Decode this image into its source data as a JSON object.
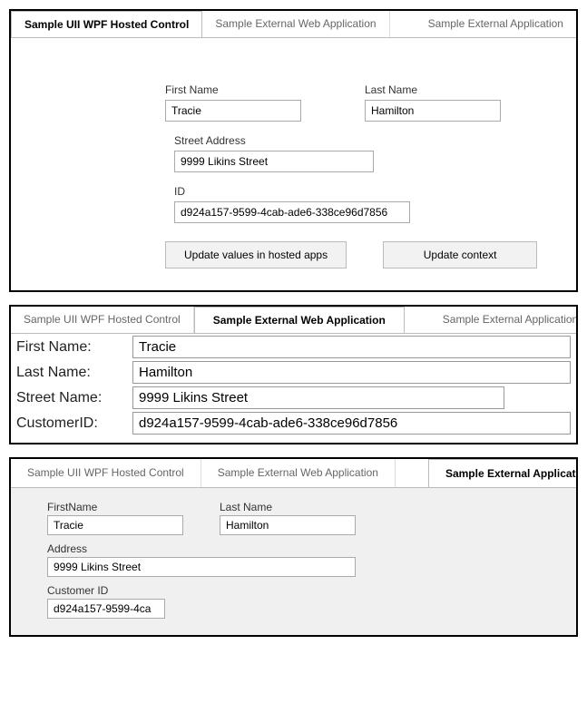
{
  "tabs": {
    "wpf": "Sample UII WPF Hosted Control",
    "web": "Sample External Web Application",
    "ext": "Sample External Application"
  },
  "panel1": {
    "firstNameLabel": "First Name",
    "firstName": "Tracie",
    "lastNameLabel": "Last Name",
    "lastName": "Hamilton",
    "streetLabel": "Street Address",
    "street": "9999 Likins Street",
    "idLabel": "ID",
    "id": "d924a157-9599-4cab-ade6-338ce96d7856",
    "btnUpdateHosted": "Update values in hosted apps",
    "btnUpdateContext": "Update context"
  },
  "panel2": {
    "firstNameLabel": "First Name:",
    "firstName": "Tracie",
    "lastNameLabel": "Last Name:",
    "lastName": "Hamilton",
    "streetLabel": "Street Name:",
    "street": "9999 Likins Street",
    "custIdLabel": "CustomerID:",
    "custId": "d924a157-9599-4cab-ade6-338ce96d7856"
  },
  "panel3": {
    "firstNameLabel": "FirstName",
    "firstName": "Tracie",
    "lastNameLabel": "Last Name",
    "lastName": "Hamilton",
    "addressLabel": "Address",
    "address": "9999 Likins Street",
    "custIdLabel": "Customer ID",
    "custId": "d924a157-9599-4ca"
  }
}
